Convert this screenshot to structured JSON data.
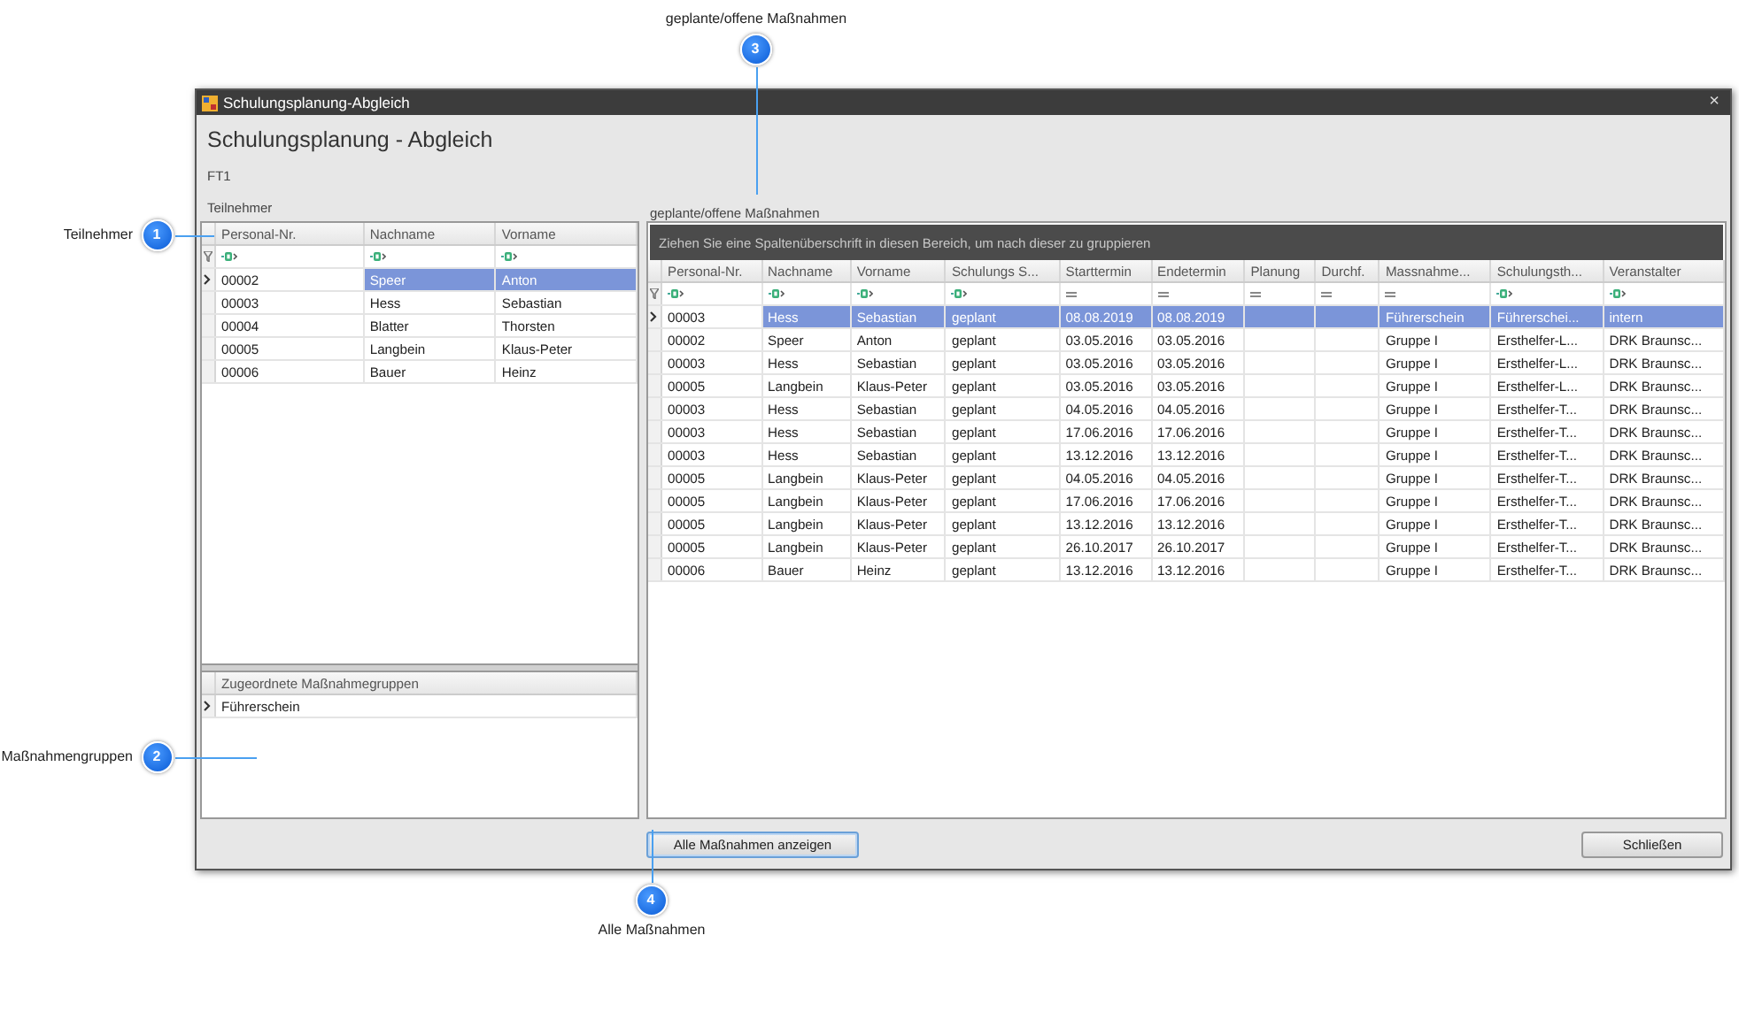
{
  "callouts": [
    {
      "number": "1",
      "label": "Teilnehmer"
    },
    {
      "number": "2",
      "label": "Maßnahmengruppen"
    },
    {
      "number": "3",
      "label": "geplante/offene Maßnahmen"
    },
    {
      "number": "4",
      "label": "Alle Maßnahmen"
    }
  ],
  "window": {
    "title": "Schulungsplanung-Abgleich",
    "close": "×",
    "heading": "Schulungsplanung - Abgleich",
    "code": "FT1",
    "participants": {
      "label": "Teilnehmer",
      "columns": [
        {
          "label": "Personal-Nr.",
          "kind": "text_filter"
        },
        {
          "label": "Nachname",
          "kind": "text_filter"
        },
        {
          "label": "Vorname",
          "kind": "text_filter"
        }
      ],
      "rows": [
        {
          "cells": [
            "00002",
            "Speer",
            "Anton"
          ],
          "selected": true,
          "current": true
        },
        {
          "cells": [
            "00003",
            "Hess",
            "Sebastian"
          ],
          "selected": false,
          "current": false
        },
        {
          "cells": [
            "00004",
            "Blatter",
            "Thorsten"
          ],
          "selected": false,
          "current": false
        },
        {
          "cells": [
            "00005",
            "Langbein",
            "Klaus-Peter"
          ],
          "selected": false,
          "current": false
        },
        {
          "cells": [
            "00006",
            "Bauer",
            "Heinz"
          ],
          "selected": false,
          "current": false
        }
      ]
    },
    "groups": {
      "columns": [
        {
          "label": "Zugeordnete Maßnahmegruppen"
        }
      ],
      "rows": [
        {
          "cells": [
            "Führerschein"
          ],
          "current": true
        }
      ]
    },
    "measures": {
      "label": "geplante/offene Maßnahmen",
      "group_hint": "Ziehen Sie eine Spaltenüberschrift in diesen Bereich, um nach dieser zu gruppieren",
      "columns": [
        {
          "label": "Personal-Nr.",
          "kind": "text_filter"
        },
        {
          "label": "Nachname",
          "kind": "text_filter"
        },
        {
          "label": "Vorname",
          "kind": "text_filter"
        },
        {
          "label": "Schulungs S...",
          "kind": "text_filter"
        },
        {
          "label": "Starttermin",
          "kind": "equals_filter"
        },
        {
          "label": "Endetermin",
          "kind": "equals_filter"
        },
        {
          "label": "Planung",
          "kind": "equals_filter"
        },
        {
          "label": "Durchf.",
          "kind": "equals_filter"
        },
        {
          "label": "Massnahme...",
          "kind": "equals_filter"
        },
        {
          "label": "Schulungsth...",
          "kind": "text_filter"
        },
        {
          "label": "Veranstalter",
          "kind": "text_filter"
        }
      ],
      "rows": [
        {
          "cells": [
            "00003",
            "Hess",
            "Sebastian",
            "geplant",
            "08.08.2019",
            "08.08.2019",
            "",
            "",
            "Führerschein",
            "Führerschei...",
            "intern"
          ],
          "selected": true,
          "current": true
        },
        {
          "cells": [
            "00002",
            "Speer",
            "Anton",
            "geplant",
            "03.05.2016",
            "03.05.2016",
            "",
            "",
            "Gruppe I",
            "Ersthelfer-L...",
            "DRK Braunsc..."
          ],
          "selected": false,
          "current": false
        },
        {
          "cells": [
            "00003",
            "Hess",
            "Sebastian",
            "geplant",
            "03.05.2016",
            "03.05.2016",
            "",
            "",
            "Gruppe I",
            "Ersthelfer-L...",
            "DRK Braunsc..."
          ],
          "selected": false,
          "current": false
        },
        {
          "cells": [
            "00005",
            "Langbein",
            "Klaus-Peter",
            "geplant",
            "03.05.2016",
            "03.05.2016",
            "",
            "",
            "Gruppe I",
            "Ersthelfer-L...",
            "DRK Braunsc..."
          ],
          "selected": false,
          "current": false
        },
        {
          "cells": [
            "00003",
            "Hess",
            "Sebastian",
            "geplant",
            "04.05.2016",
            "04.05.2016",
            "",
            "",
            "Gruppe I",
            "Ersthelfer-T...",
            "DRK Braunsc..."
          ],
          "selected": false,
          "current": false
        },
        {
          "cells": [
            "00003",
            "Hess",
            "Sebastian",
            "geplant",
            "17.06.2016",
            "17.06.2016",
            "",
            "",
            "Gruppe I",
            "Ersthelfer-T...",
            "DRK Braunsc..."
          ],
          "selected": false,
          "current": false
        },
        {
          "cells": [
            "00003",
            "Hess",
            "Sebastian",
            "geplant",
            "13.12.2016",
            "13.12.2016",
            "",
            "",
            "Gruppe I",
            "Ersthelfer-T...",
            "DRK Braunsc..."
          ],
          "selected": false,
          "current": false
        },
        {
          "cells": [
            "00005",
            "Langbein",
            "Klaus-Peter",
            "geplant",
            "04.05.2016",
            "04.05.2016",
            "",
            "",
            "Gruppe I",
            "Ersthelfer-T...",
            "DRK Braunsc..."
          ],
          "selected": false,
          "current": false
        },
        {
          "cells": [
            "00005",
            "Langbein",
            "Klaus-Peter",
            "geplant",
            "17.06.2016",
            "17.06.2016",
            "",
            "",
            "Gruppe I",
            "Ersthelfer-T...",
            "DRK Braunsc..."
          ],
          "selected": false,
          "current": false
        },
        {
          "cells": [
            "00005",
            "Langbein",
            "Klaus-Peter",
            "geplant",
            "13.12.2016",
            "13.12.2016",
            "",
            "",
            "Gruppe I",
            "Ersthelfer-T...",
            "DRK Braunsc..."
          ],
          "selected": false,
          "current": false
        },
        {
          "cells": [
            "00005",
            "Langbein",
            "Klaus-Peter",
            "geplant",
            "26.10.2017",
            "26.10.2017",
            "",
            "",
            "Gruppe I",
            "Ersthelfer-T...",
            "DRK Braunsc..."
          ],
          "selected": false,
          "current": false
        },
        {
          "cells": [
            "00006",
            "Bauer",
            "Heinz",
            "geplant",
            "13.12.2016",
            "13.12.2016",
            "",
            "",
            "Gruppe I",
            "Ersthelfer-T...",
            "DRK Braunsc..."
          ],
          "selected": false,
          "current": false
        }
      ]
    },
    "buttons": [
      {
        "label": "Alle Maßnahmen anzeigen",
        "focused": true
      },
      {
        "label": "Schließen",
        "focused": false
      }
    ]
  }
}
